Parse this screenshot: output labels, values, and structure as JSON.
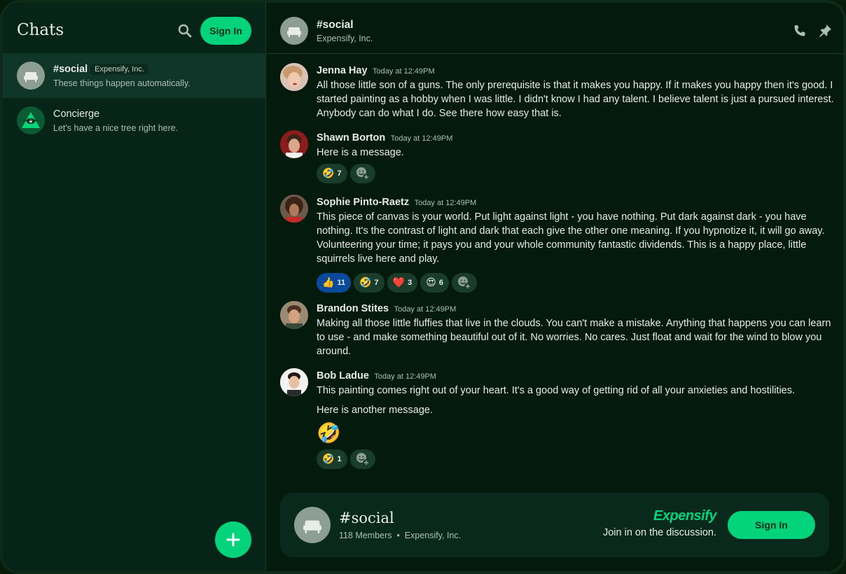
{
  "sidebar": {
    "title": "Chats",
    "signin_label": "Sign In",
    "chats": [
      {
        "name": "#social",
        "badge": "Expensify, Inc.",
        "preview": "These things happen automatically.",
        "active": true
      },
      {
        "name": "Concierge",
        "badge": "",
        "preview": "Let's have a nice tree right here.",
        "active": false
      }
    ]
  },
  "header": {
    "title": "#social",
    "subtitle": "Expensify, Inc."
  },
  "messages": [
    {
      "author": "Jenna Hay",
      "time": "Today at 12:49PM",
      "body": [
        "All those little son of a guns. The only prerequisite is that it makes you happy. If it makes you happy then it's good. I started painting as a hobby when I was little. I didn't know I had any talent. I believe talent is just a pursued interest. Anybody can do what I do. See there how easy that is."
      ]
    },
    {
      "author": "Shawn Borton",
      "time": "Today at 12:49PM",
      "body": [
        "Here is a message."
      ],
      "reactions": [
        {
          "emoji": "🤣",
          "count": "7"
        }
      ]
    },
    {
      "author": "Sophie Pinto-Raetz",
      "time": "Today at 12:49PM",
      "body": [
        "This piece of canvas is your world. Put light against light - you have nothing. Put dark against dark - you have nothing. It's the contrast of light and dark that each give the other one meaning. If you hypnotize it, it will go away. Volunteering your time; it pays you and your whole community fantastic dividends. This is a happy place, little squirrels live here and play."
      ],
      "reactions": [
        {
          "emoji": "👍",
          "count": "11"
        },
        {
          "emoji": "🤣",
          "count": "7"
        },
        {
          "emoji": "❤️",
          "count": "3"
        },
        {
          "emoji": "😍",
          "count": "6"
        }
      ]
    },
    {
      "author": "Brandon Stites",
      "time": "Today at 12:49PM",
      "body": [
        "Making all those little fluffies that live in the clouds. You can't make a mistake. Anything that happens you can learn to use - and make something beautiful out of it. No worries. No cares. Just float and wait for the wind to blow you around."
      ]
    },
    {
      "author": "Bob Ladue",
      "time": "Today at 12:49PM",
      "body": [
        "This painting comes right out of your heart. It's a good way of getting rid of all your anxieties and hostilities.",
        "Here is another message."
      ],
      "big_emoji": "🤣",
      "reactions": [
        {
          "emoji": "🤣",
          "count": "1"
        }
      ]
    }
  ],
  "join_card": {
    "room": "#social",
    "members": "118 Members",
    "workspace": "Expensify, Inc.",
    "brand": "Expensify",
    "cta_text": "Join in on the discussion.",
    "signin_label": "Sign In"
  },
  "icons": {
    "search": "search-icon",
    "phone": "phone-icon",
    "pin": "pin-icon",
    "add_reaction": "add-reaction-icon",
    "plus": "plus-icon"
  },
  "colors": {
    "accent": "#03d47c",
    "background": "#041a0d",
    "sidebar": "#072419",
    "reaction": "#1a3d2b",
    "reaction_mine": "#0a4a9a"
  }
}
